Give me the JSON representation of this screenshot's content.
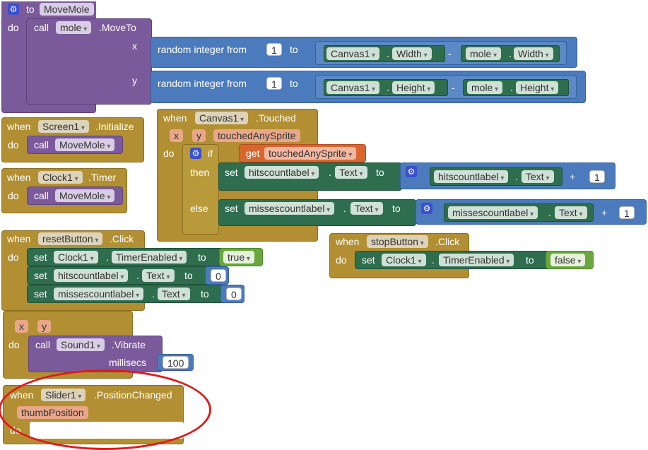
{
  "kw": {
    "to": "to",
    "do": "do",
    "call": "call",
    "when": "when",
    "set": "set",
    "if": "if",
    "then": "then",
    "else": "else",
    "get": "get",
    "x": "x",
    "y": "y",
    "minus": "-",
    "plus": "+",
    "dot": "."
  },
  "move_mole": {
    "proc_name": "MoveMole",
    "component": "mole",
    "method": ".MoveTo",
    "random_label": "random integer from",
    "from_value": "1",
    "x_comp1": "Canvas1",
    "x_prop1": "Width",
    "x_comp2": "mole",
    "x_prop2": "Width",
    "y_comp1": "Canvas1",
    "y_prop1": "Height",
    "y_comp2": "mole",
    "y_prop2": "Height"
  },
  "screen_init": {
    "component": "Screen1",
    "event": ".Initialize",
    "call": "MoveMole"
  },
  "clock_timer": {
    "component": "Clock1",
    "event": ".Timer",
    "call": "MoveMole"
  },
  "canvas_touched": {
    "component": "Canvas1",
    "event": ".Touched",
    "param3": "touchedAnySprite",
    "get_var": "touchedAnySprite",
    "then_comp": "hitscountlabel",
    "then_prop": "Text",
    "then_num": "1",
    "else_comp": "missescountlabel",
    "else_prop": "Text",
    "else_num": "1"
  },
  "reset_click": {
    "component": "resetButton",
    "event": ".Click",
    "row1_comp": "Clock1",
    "row1_prop": "TimerEnabled",
    "row1_value": "true",
    "row2_comp": "hitscountlabel",
    "row2_prop": "Text",
    "row2_value": "0",
    "row3_comp": "missescountlabel",
    "row3_prop": "Text",
    "row3_value": "0"
  },
  "stop_click": {
    "component": "stopButton",
    "event": ".Click",
    "comp": "Clock1",
    "prop": "TimerEnabled",
    "value": "false"
  },
  "vibrate": {
    "component": "Sound1",
    "method": ".Vibrate",
    "arg_label": "millisecs",
    "value": "100"
  },
  "slider": {
    "component": "Slider1",
    "event": ".PositionChanged",
    "param": "thumbPosition"
  }
}
